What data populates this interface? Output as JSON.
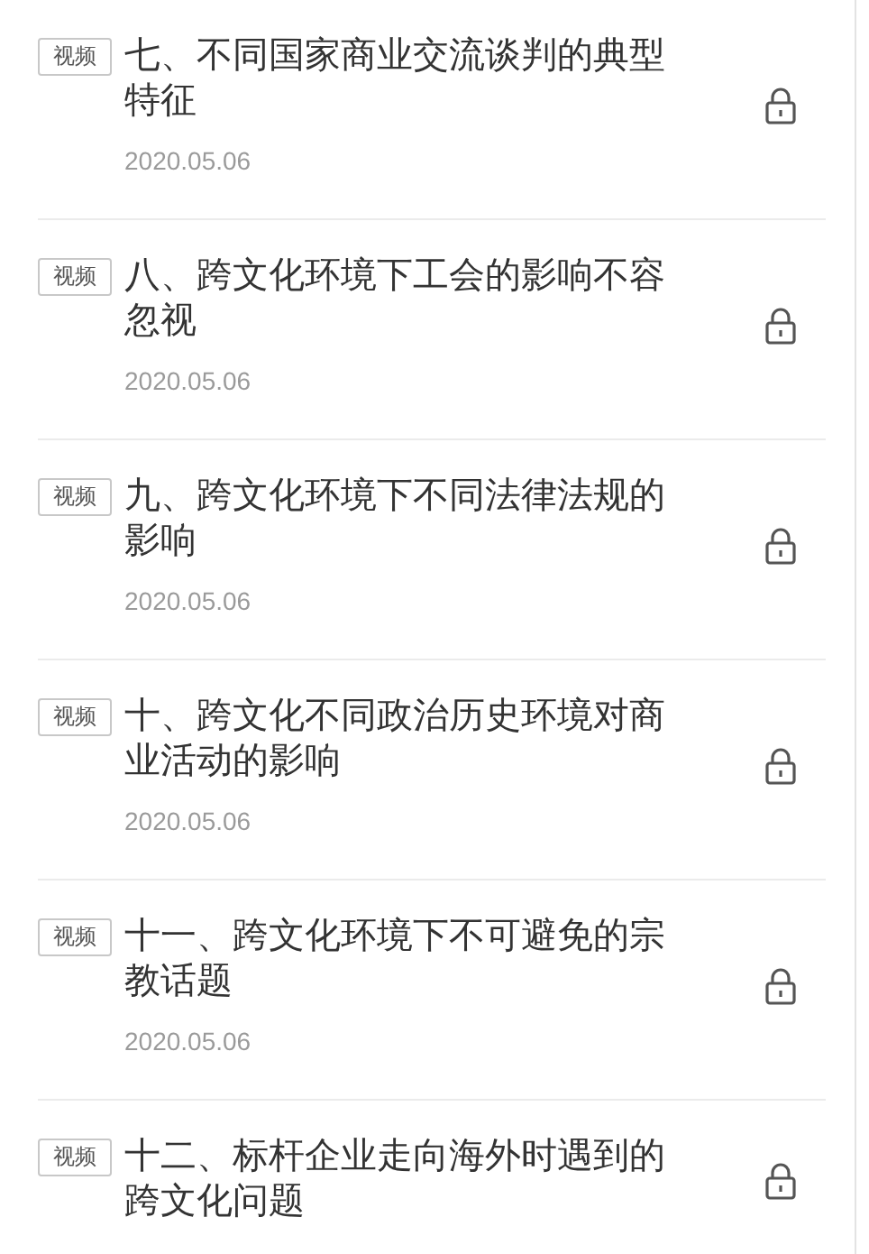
{
  "lessons": [
    {
      "tag": "视频",
      "title": "七、不同国家商业交流谈判的典型特征",
      "date": "2020.05.06",
      "locked": true
    },
    {
      "tag": "视频",
      "title": "八、跨文化环境下工会的影响不容忽视",
      "date": "2020.05.06",
      "locked": true
    },
    {
      "tag": "视频",
      "title": "九、跨文化环境下不同法律法规的影响",
      "date": "2020.05.06",
      "locked": true
    },
    {
      "tag": "视频",
      "title": "十、跨文化不同政治历史环境对商业活动的影响",
      "date": "2020.05.06",
      "locked": true
    },
    {
      "tag": "视频",
      "title": "十一、跨文化环境下不可避免的宗教话题",
      "date": "2020.05.06",
      "locked": true
    },
    {
      "tag": "视频",
      "title": "十二、标杆企业走向海外时遇到的跨文化问题",
      "locked": true
    }
  ]
}
